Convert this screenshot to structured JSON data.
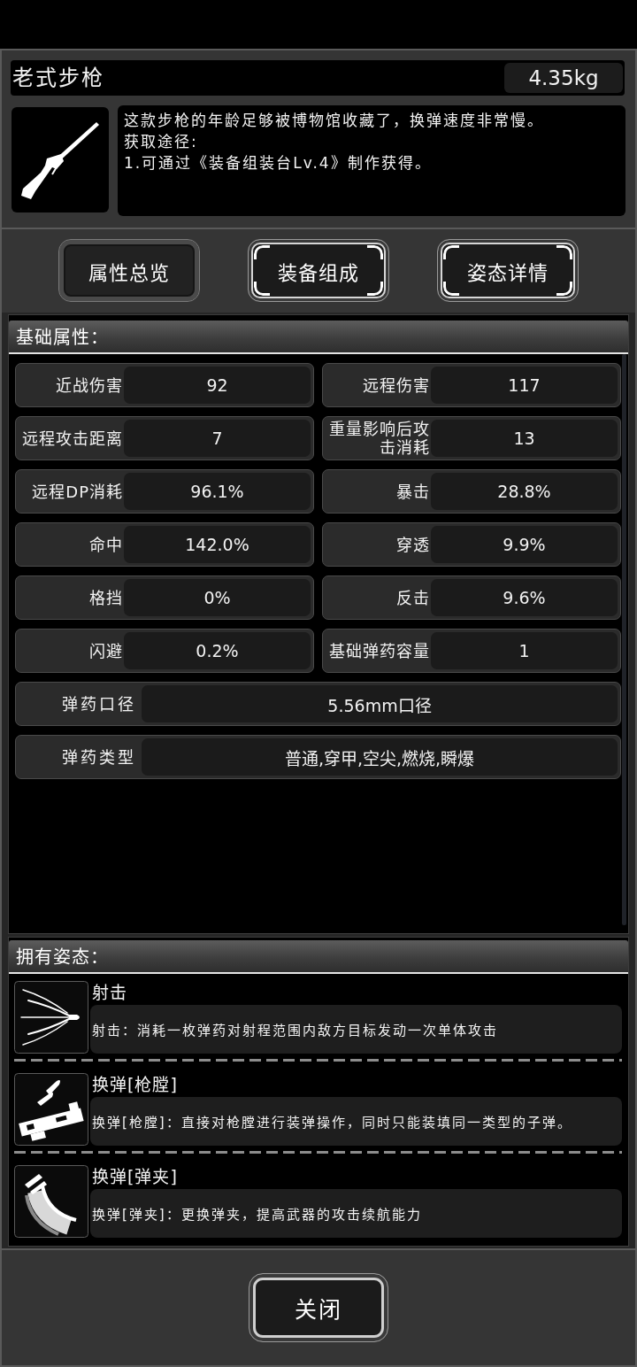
{
  "item": {
    "name": "老式步枪",
    "weight": "4.35kg",
    "description": [
      "这款步枪的年龄足够被博物馆收藏了，换弹速度非常慢。",
      "获取途径:",
      "1.可通过《装备组装台Lv.4》制作获得。"
    ]
  },
  "tabs": [
    {
      "label": "属性总览",
      "selected": true
    },
    {
      "label": "装备组成",
      "selected": false
    },
    {
      "label": "姿态详情",
      "selected": false
    }
  ],
  "base_attributes": {
    "title": "基础属性：",
    "stats": [
      {
        "kind": "half",
        "label": "近战伤害",
        "value": "92"
      },
      {
        "kind": "half",
        "label": "远程伤害",
        "value": "117"
      },
      {
        "kind": "half",
        "label": "远程攻击距离",
        "value": "7"
      },
      {
        "kind": "half",
        "label": "重量影响后攻击消耗",
        "value": "13"
      },
      {
        "kind": "half",
        "label": "远程DP消耗",
        "value": "96.1%"
      },
      {
        "kind": "half",
        "label": "暴击",
        "value": "28.8%"
      },
      {
        "kind": "half",
        "label": "命中",
        "value": "142.0%"
      },
      {
        "kind": "half",
        "label": "穿透",
        "value": "9.9%"
      },
      {
        "kind": "half",
        "label": "格挡",
        "value": "0%"
      },
      {
        "kind": "half",
        "label": "反击",
        "value": "9.6%"
      },
      {
        "kind": "half",
        "label": "闪避",
        "value": "0.2%"
      },
      {
        "kind": "half",
        "label": "基础弹药容量",
        "value": "1"
      },
      {
        "kind": "full",
        "label": "弹药口径",
        "value": "5.56mm口径"
      },
      {
        "kind": "full",
        "label": "弹药类型",
        "value": "普通,穿甲,空尖,燃烧,瞬爆"
      }
    ]
  },
  "stances": {
    "title": "拥有姿态：",
    "items": [
      {
        "kind": "shoot",
        "name": "射击",
        "description": "射击：消耗一枚弹药对射程范围内敌方目标发动一次单体攻击"
      },
      {
        "kind": "chamber",
        "name": "换弹[枪膛]",
        "description": "换弹[枪膛]：直接对枪膛进行装弹操作，同时只能装填同一类型的子弹。"
      },
      {
        "kind": "magazine",
        "name": "换弹[弹夹]",
        "description": "换弹[弹夹]：更换弹夹，提高武器的攻击续航能力"
      }
    ]
  },
  "close_button": {
    "label": "关闭"
  }
}
